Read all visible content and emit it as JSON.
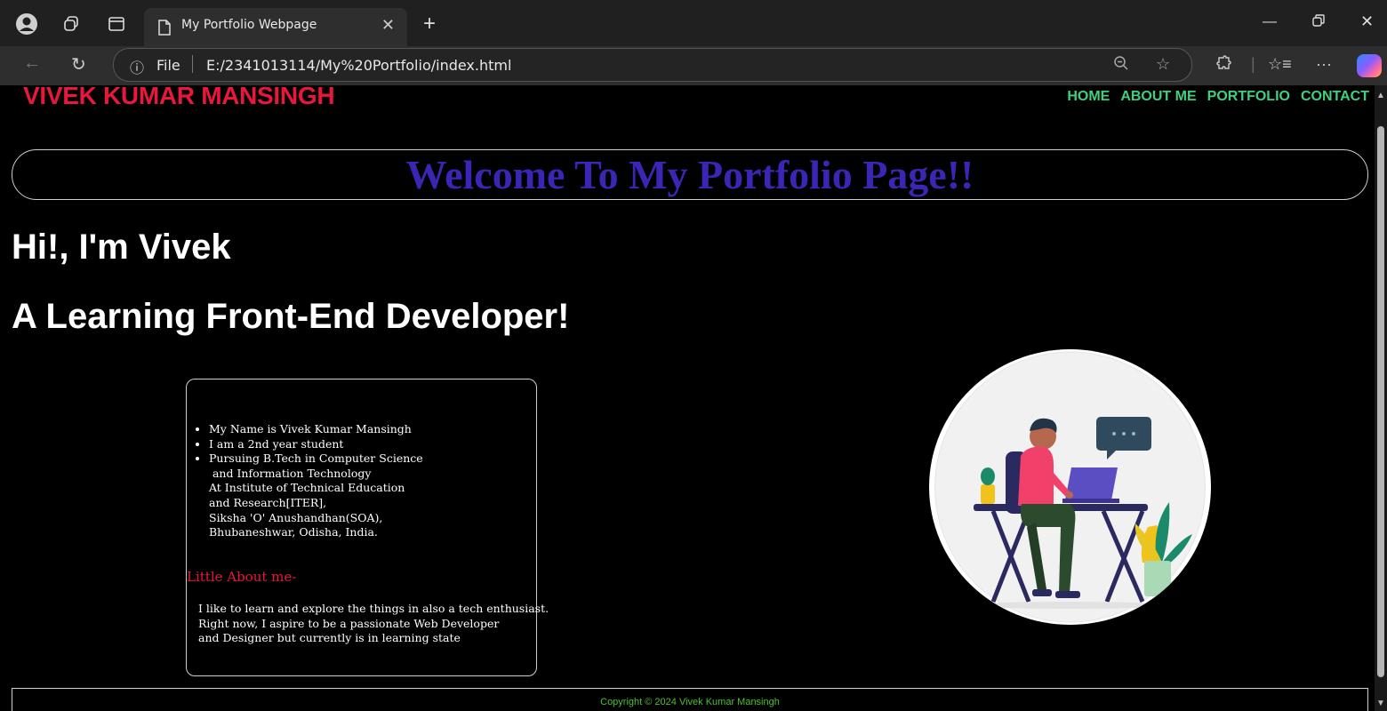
{
  "browser": {
    "tab_title": "My Portfolio Webpage",
    "address_scheme": "File",
    "address_url": "E:/2341013114/My%20Portfolio/index.html"
  },
  "header": {
    "logo": "VIVEK KUMAR MANSINGH",
    "nav": [
      "HOME",
      "ABOUT ME",
      "PORTFOLIO",
      "CONTACT"
    ]
  },
  "hero": {
    "banner": "Welcome To My Portfolio Page!!",
    "greeting": "Hi!, I'm Vivek",
    "role": "A Learning Front-End Developer!"
  },
  "info": {
    "bullets": [
      "My Name is Vivek Kumar Mansingh",
      "I am a 2nd year student",
      "Pursuing B.Tech in Computer Science"
    ],
    "bullet3_cont": [
      " and Information Technology",
      "At Institute of Technical Education",
      "and Research[ITER],",
      "Siksha 'O' Anushandhan(SOA),",
      "Bhubaneshwar, Odisha, India."
    ],
    "about_heading": "Little About me-",
    "about_lines": [
      "I like to learn and explore the things in also a tech enthusiast.",
      "Right now, I aspire to be a passionate Web Developer",
      "and Designer but currently is in learning state"
    ]
  },
  "footer": {
    "copyright": "Copyright © 2024 Vivek Kumar Mansingh"
  },
  "colors": {
    "logo": "#e8173b",
    "nav": "#3fd07e",
    "banner": "#3a26b5",
    "footer": "#4ac22b",
    "page_bg": "#000000"
  }
}
